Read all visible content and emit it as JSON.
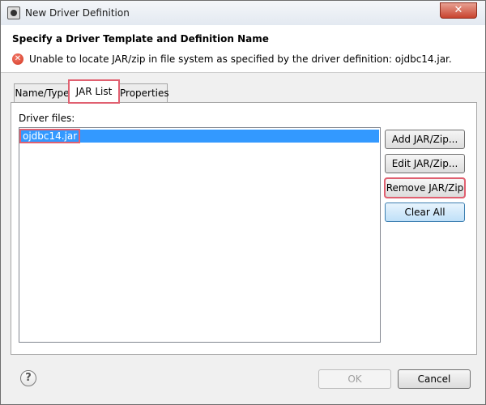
{
  "window": {
    "title": "New Driver Definition",
    "close_glyph": "✕"
  },
  "header": {
    "title": "Specify a Driver Template and Definition Name",
    "error_icon_glyph": "✕",
    "error_message": "Unable to locate JAR/zip in file system as specified by the driver definition: ojdbc14.jar."
  },
  "tabs": [
    {
      "label": "Name/Type"
    },
    {
      "label": "JAR List"
    },
    {
      "label": "Properties"
    }
  ],
  "active_tab": "JAR List",
  "panel": {
    "driver_files_label": "Driver files:",
    "files": [
      "ojdbc14.jar"
    ]
  },
  "side_buttons": {
    "add": "Add JAR/Zip...",
    "edit": "Edit JAR/Zip...",
    "remove": "Remove JAR/Zip",
    "clear": "Clear All"
  },
  "footer": {
    "help_glyph": "?",
    "ok": "OK",
    "cancel": "Cancel"
  },
  "colors": {
    "selection": "#3399ff",
    "highlight": "#e06070",
    "error": "#d23821"
  }
}
